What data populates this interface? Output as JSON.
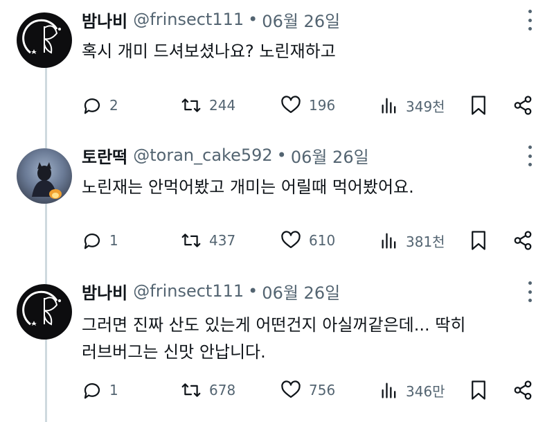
{
  "tweets": [
    {
      "name": "밤나비",
      "handle": "@frinsect111",
      "date": "06월 26일",
      "text_lines": [
        "혹시 개미 드셔보셨나요? 노린재하고"
      ],
      "replies": "2",
      "retweets": "244",
      "likes": "196",
      "views": "349천",
      "avatar": "moth-logo"
    },
    {
      "name": "토란떡",
      "handle": "@toran_cake592",
      "date": "06월 26일",
      "text_lines": [
        "노린재는 안먹어봤고 개미는 어릴때 먹어봤어요."
      ],
      "replies": "1",
      "retweets": "437",
      "likes": "610",
      "views": "381천",
      "avatar": "anime-character-photo"
    },
    {
      "name": "밤나비",
      "handle": "@frinsect111",
      "date": "06월 26일",
      "text_lines": [
        "그러면 진짜 산도 있는게 어떤건지 아실꺼같은데... 딱히",
        "러브버그는 신맛 안납니다."
      ],
      "replies": "1",
      "retweets": "678",
      "likes": "756",
      "views": "346만",
      "avatar": "moth-logo"
    }
  ],
  "colors": {
    "text": "#0f1419",
    "secondary": "#536471",
    "thread_line": "#cfd9de",
    "background": "#ffffff"
  },
  "icons": [
    "reply-icon",
    "retweet-icon",
    "like-icon",
    "views-icon",
    "bookmark-icon",
    "share-icon",
    "more-icon"
  ]
}
